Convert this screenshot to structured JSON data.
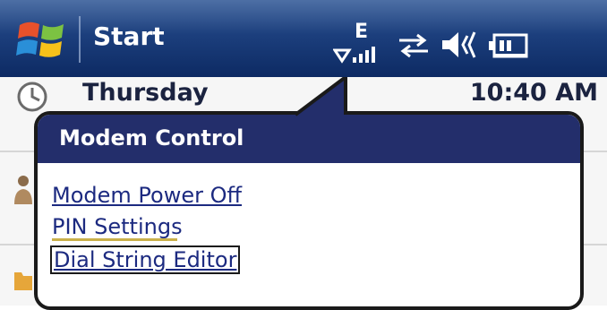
{
  "startbar": {
    "start_label": "Start",
    "network_letter": "E"
  },
  "today": {
    "day": "Thursday",
    "time": "10:40 AM"
  },
  "popup": {
    "title": "Modem Control",
    "items": [
      {
        "label": "Modem Power Off"
      },
      {
        "label": "PIN Settings"
      },
      {
        "label": "Dial String Editor"
      }
    ]
  },
  "icons": [
    "windows-logo-icon",
    "signal-icon",
    "sync-arrows-icon",
    "speaker-icon",
    "battery-icon",
    "clock-icon",
    "owner-icon",
    "folder-icon"
  ],
  "colors": {
    "startbar": "#1c3f7d",
    "popup_header": "#232e6b",
    "link": "#1c2a80"
  }
}
